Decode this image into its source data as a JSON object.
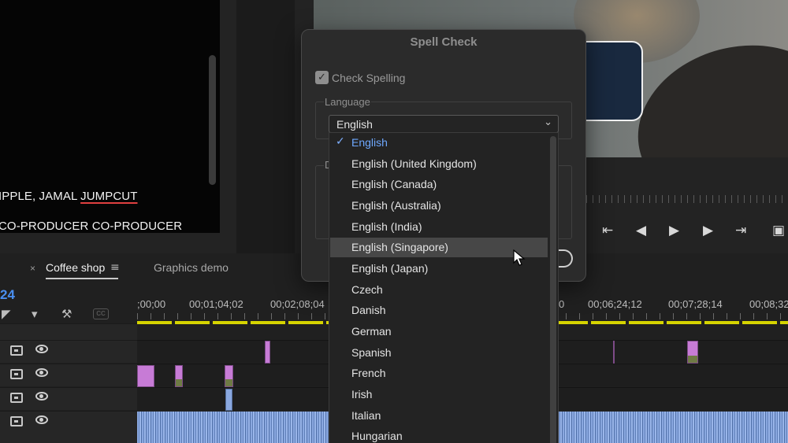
{
  "source_monitor": {
    "credit_line_1": "IPPLE, JAMAL ",
    "credit_line_1_misspelled": "JUMPCUT",
    "credit_line_2": "CO-PRODUCER CO-PRODUCER"
  },
  "timeline": {
    "tabs": [
      {
        "label": "Coffee shop",
        "active": true
      },
      {
        "label": "Graphics demo",
        "active": false
      }
    ],
    "close_glyph": "×",
    "menu_glyph": "≡",
    "timecode_fragment": "24",
    "cc_label": "CC",
    "ruler": [
      ";00;00",
      "00;01;04;02",
      "00;02;08;04",
      "0",
      "00;06;24;12",
      "00;07;28;14",
      "00;08;32"
    ]
  },
  "spell_check_dialog": {
    "title": "Spell Check",
    "check_spelling_label": "Check Spelling",
    "check_spelling_checked": true,
    "language_group_label": "Language",
    "selected_language": "English",
    "second_group_label_fragment": "D"
  },
  "language_dropdown": {
    "selected": "English",
    "hovered": "English (Singapore)",
    "options": [
      "English",
      "English (United Kingdom)",
      "English (Canada)",
      "English (Australia)",
      "English (India)",
      "English (Singapore)",
      "English (Japan)",
      "Czech",
      "Danish",
      "German",
      "Spanish",
      "French",
      "Irish",
      "Italian",
      "Hungarian"
    ]
  },
  "icons": {
    "check": "✓",
    "chevron": "⌄",
    "transport": [
      "step-back-to-in-icon",
      "step-back-frame-icon",
      "play-icon",
      "step-forward-frame-icon",
      "go-to-out-icon",
      "export-frame-icon"
    ]
  },
  "colors": {
    "accent_blue": "#4a8ff0",
    "video_clip": "#c77bd6",
    "audio_clip": "#8aa8e0",
    "work_area_bar": "#d6d400"
  }
}
